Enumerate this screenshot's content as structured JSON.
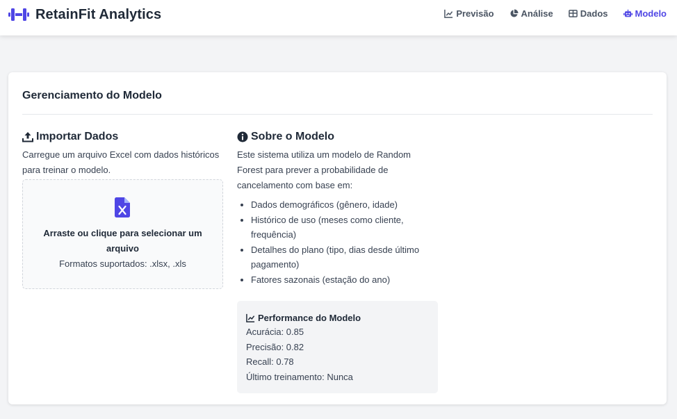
{
  "app": {
    "name": "RetainFit Analytics",
    "icon": "dumbbell-icon",
    "accent_color": "#4f46e5"
  },
  "nav": {
    "items": [
      {
        "label": "Previsão",
        "icon": "chart-line-icon",
        "active": false
      },
      {
        "label": "Análise",
        "icon": "pie-chart-icon",
        "active": false
      },
      {
        "label": "Dados",
        "icon": "table-icon",
        "active": false
      },
      {
        "label": "Modelo",
        "icon": "robot-icon",
        "active": true
      }
    ]
  },
  "page": {
    "title": "Gerenciamento do Modelo"
  },
  "import": {
    "title": "Importar Dados",
    "icon": "upload-icon",
    "description": "Carregue um arquivo Excel com dados históricos para treinar o modelo.",
    "dropzone": {
      "icon": "excel-file-icon",
      "title": "Arraste ou clique para selecionar um arquivo",
      "subtitle": "Formatos suportados: .xlsx, .xls"
    }
  },
  "about": {
    "title": "Sobre o Modelo",
    "icon": "info-circle-icon",
    "description": "Este sistema utiliza um modelo de Random Forest para prever a probabilidade de cancelamento com base em:",
    "factors": [
      "Dados demográficos (gênero, idade)",
      "Histórico de uso (meses como cliente, frequência)",
      "Detalhes do plano (tipo, dias desde último pagamento)",
      "Fatores sazonais (estação do ano)"
    ]
  },
  "performance": {
    "title": "Performance do Modelo",
    "icon": "chart-line-icon",
    "lines": [
      "Acurácia: 0.85",
      "Precisão: 0.82",
      "Recall: 0.78",
      "Último treinamento: Nunca"
    ]
  }
}
